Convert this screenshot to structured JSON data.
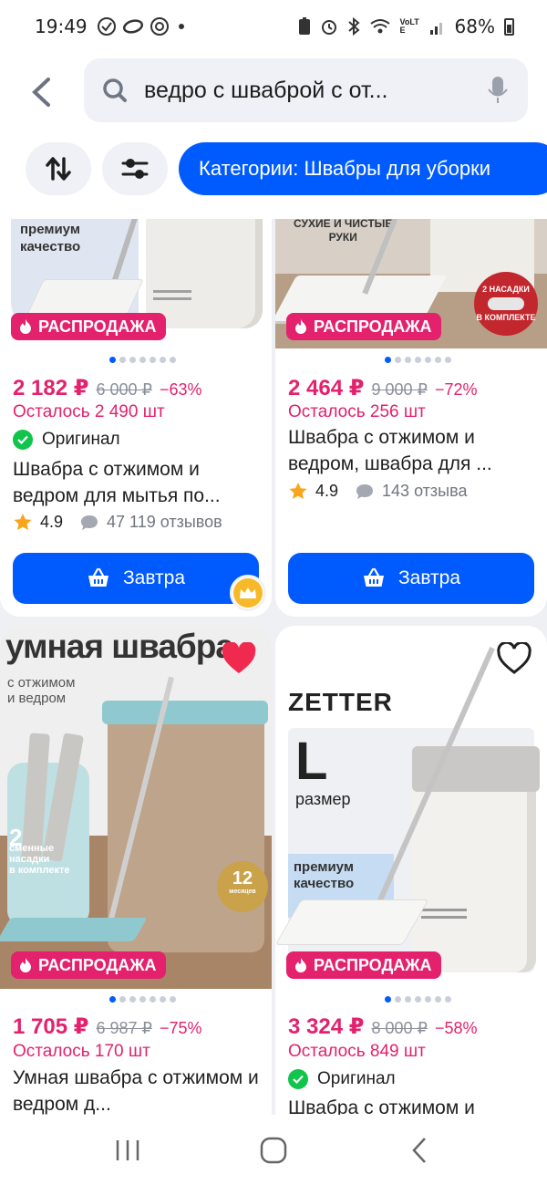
{
  "status_bar": {
    "time": "19:49",
    "battery": "68%",
    "icons": [
      "check-circle-icon",
      "ring-icon",
      "at-icon",
      "dot-icon",
      "battery-saver-icon",
      "alarm-icon",
      "bluetooth-icon",
      "wifi-icon",
      "volte-icon",
      "signal-icon",
      "battery-icon"
    ],
    "network_label": "VoLTE"
  },
  "search": {
    "query": "ведро с шваброй с от..."
  },
  "chips": {
    "category": "Категории: Швабры для уборки"
  },
  "colors": {
    "accent": "#005bff",
    "sale": "#e3216d",
    "original_check": "#10c44c"
  },
  "products": [
    {
      "img_texts": [
        "премиум",
        "качество"
      ],
      "badge": "РАСПРОДАЖА",
      "price": "2 182 ₽",
      "old_price": "6 000 ₽",
      "discount": "−63%",
      "left": "Осталось 2 490 шт",
      "original": "Оригинал",
      "title": "Швабра с отжимом и ведром для мытья по...",
      "rating": "4.9",
      "reviews": "47 119 отзывов",
      "button": "Завтра"
    },
    {
      "img_texts": [
        "СУХИЕ И ЧИСТЫЕ",
        "РУКИ",
        "2 НАСАДКИ",
        "В КОМПЛЕКТЕ"
      ],
      "badge": "РАСПРОДАЖА",
      "price": "2 464 ₽",
      "old_price": "9 000 ₽",
      "discount": "−72%",
      "left": "Осталось 256 шт",
      "title": "Швабра с отжимом и ведром, швабра для ...",
      "rating": "4.9",
      "reviews": "143 отзыва",
      "button": "Завтра"
    },
    {
      "img_texts": [
        "умная швабра",
        "с отжимом",
        "и ведром",
        "2",
        "сменные",
        "насадки",
        "в комплекте",
        "12",
        "месяцев"
      ],
      "badge": "РАСПРОДАЖА",
      "price": "1 705 ₽",
      "old_price": "6 987 ₽",
      "discount": "−75%",
      "left": "Осталось 170 шт",
      "title": "Умная швабра с отжимом и ведром д..."
    },
    {
      "img_texts": [
        "ZETTER",
        "L",
        "размер",
        "премиум",
        "качество"
      ],
      "badge": "РАСПРОДАЖА",
      "price": "3 324 ₽",
      "old_price": "8 000 ₽",
      "discount": "−58%",
      "left": "Осталось 849 шт",
      "original": "Оригинал",
      "title": "Швабра с отжимом и"
    }
  ]
}
